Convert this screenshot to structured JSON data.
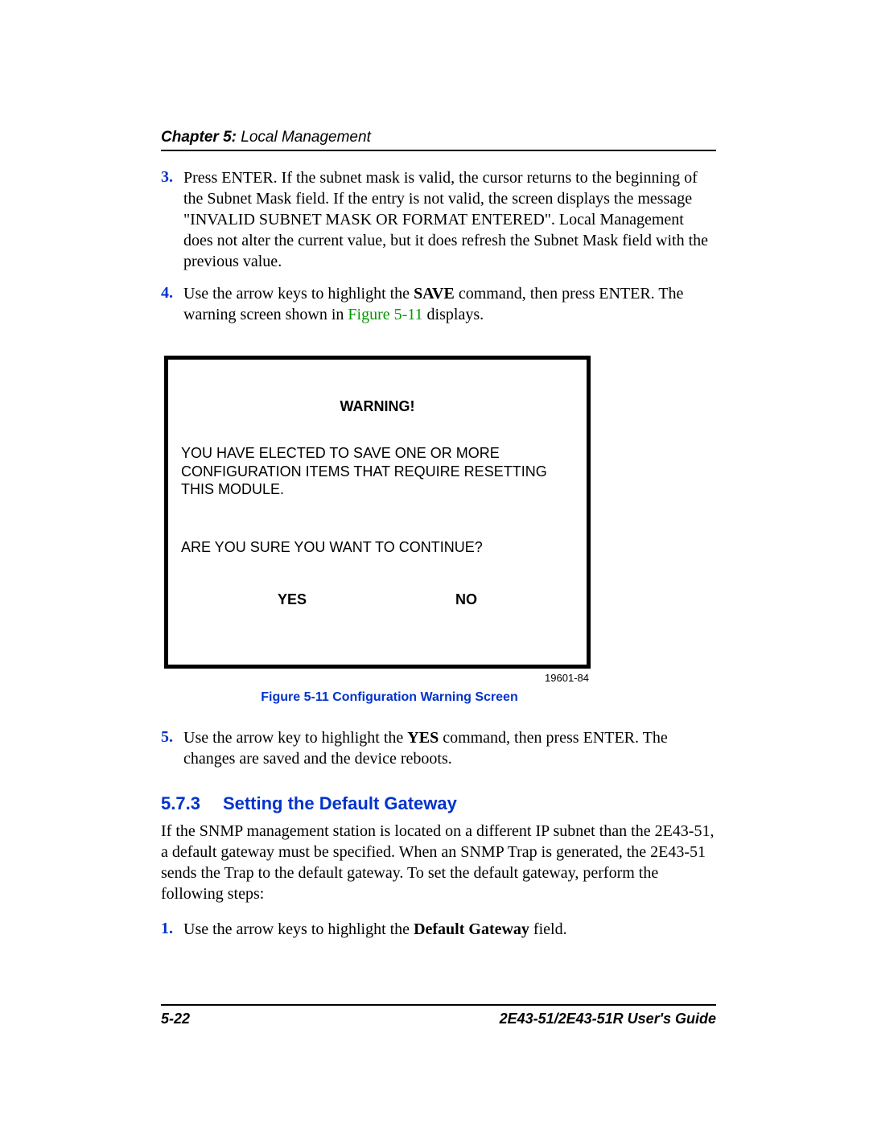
{
  "header": {
    "chapter_label": "Chapter 5:",
    "chapter_title": " Local Management"
  },
  "steps_a": {
    "s3": {
      "num": "3.",
      "text": "Press ENTER. If the subnet mask is valid, the cursor returns to the beginning of the Subnet Mask field. If the entry is not valid, the screen displays the message \"INVALID SUBNET MASK OR FORMAT ENTERED\". Local Management does not alter the current value, but it does refresh the Subnet Mask field with the previous value."
    },
    "s4": {
      "num": "4.",
      "text_a": "Use the arrow keys to highlight the ",
      "save": "SAVE",
      "text_b": " command, then press ENTER. The warning screen shown in ",
      "figref": "Figure 5-11",
      "text_c": " displays."
    }
  },
  "figure": {
    "title": "WARNING!",
    "para": "YOU HAVE ELECTED TO SAVE ONE OR MORE CONFIGURATION ITEMS THAT REQUIRE RESETTING THIS MODULE.",
    "question": "ARE YOU SURE YOU WANT TO CONTINUE?",
    "yes": "YES",
    "no": "NO",
    "refnum": "19601-84",
    "caption": "Figure 5-11   Configuration Warning Screen"
  },
  "steps_b": {
    "s5": {
      "num": "5.",
      "text_a": "Use the arrow key to highlight the ",
      "yes": "YES",
      "text_b": " command, then press ENTER. The changes are saved and the device reboots."
    }
  },
  "section": {
    "number": "5.7.3",
    "title": "Setting the Default Gateway",
    "body": "If the SNMP management station is located on a different IP subnet than the 2E43-51, a default gateway must be specified. When an SNMP Trap is generated, the 2E43-51 sends the Trap to the default gateway. To set the default gateway, perform the following steps:"
  },
  "steps_c": {
    "s1": {
      "num": "1.",
      "text_a": "Use the arrow keys to highlight the ",
      "bold": "Default Gateway",
      "text_b": " field."
    }
  },
  "footer": {
    "page": "5-22",
    "guide": "2E43-51/2E43-51R User's Guide"
  }
}
